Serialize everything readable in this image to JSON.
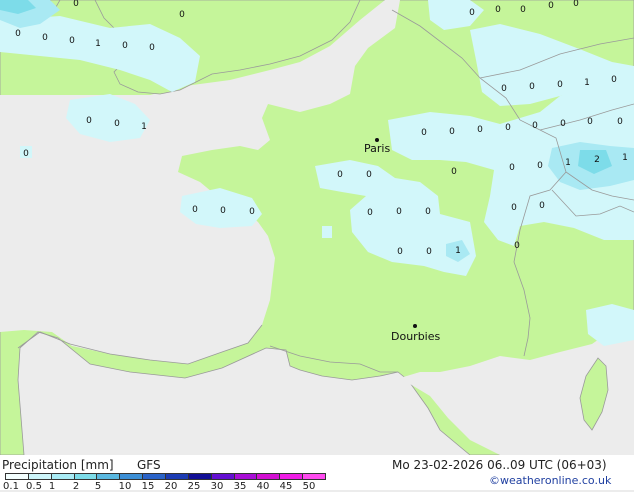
{
  "footer": {
    "title": "Precipitation [mm]",
    "model": "GFS",
    "datetime": "Mo 23-02-2026 06..09 UTC (06+03)",
    "credit": "©weatheronline.co.uk"
  },
  "legend": {
    "ticks": [
      "0.1",
      "0.5",
      "1",
      "2",
      "5",
      "10",
      "15",
      "20",
      "25",
      "30",
      "35",
      "40",
      "45",
      "50"
    ],
    "colors": [
      "#f4ffff",
      "#cdf5fa",
      "#a9ebf5",
      "#7ddce9",
      "#5ab8e0",
      "#3c8fd6",
      "#2a63c8",
      "#1c3cb4",
      "#120f96",
      "#6410d2",
      "#a80fd6",
      "#d210d2",
      "#f01ee6",
      "#ff4bf0"
    ]
  },
  "map": {
    "colors": {
      "sea": "#ececec",
      "land": "#c5f59a",
      "rain_light": "#d2f7fa",
      "rain_mid": "#a9e9f3",
      "border": "#9a9a9a"
    },
    "cities": [
      {
        "name": "Paris"
      },
      {
        "name": "Dourbies"
      }
    ],
    "values": [
      "0",
      "0",
      "0",
      "1",
      "0",
      "0",
      "0",
      "0",
      "0",
      "0",
      "0",
      "0",
      "0",
      "0",
      "0",
      "1",
      "0",
      "0",
      "0",
      "0",
      "0",
      "0",
      "0",
      "0",
      "0",
      "0",
      "0",
      "0",
      "0",
      "0",
      "0",
      "0",
      "0",
      "0",
      "0",
      "0",
      "0",
      "1",
      "1",
      "2",
      "1",
      "0",
      "0",
      "0",
      "0",
      "0",
      "1",
      "0",
      "0",
      "0"
    ]
  }
}
